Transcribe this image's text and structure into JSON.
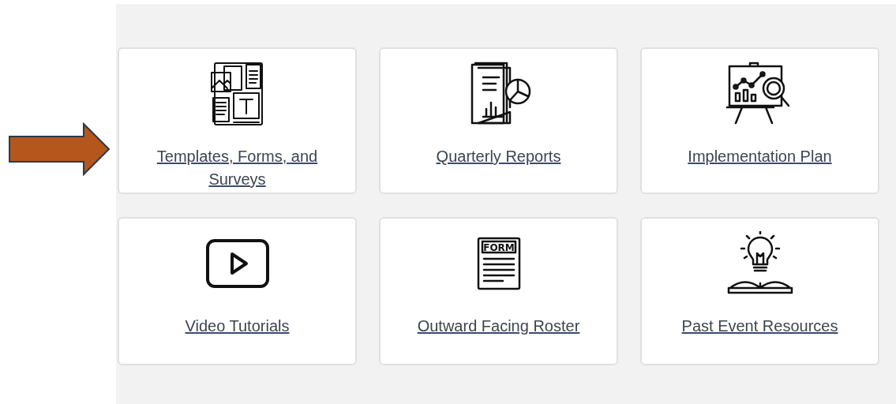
{
  "pointer_arrow": {
    "color": "#b5561c"
  },
  "tiles": [
    {
      "label": "Templates, Forms, and Surveys",
      "kind": "templates"
    },
    {
      "label": "Quarterly Reports",
      "kind": "reports"
    },
    {
      "label": "Implementation Plan",
      "kind": "plan"
    },
    {
      "label": "Video Tutorials",
      "kind": "video"
    },
    {
      "label": "Outward Facing Roster",
      "kind": "form",
      "icon_text": "FORM"
    },
    {
      "label": "Past Event Resources",
      "kind": "idea"
    }
  ]
}
